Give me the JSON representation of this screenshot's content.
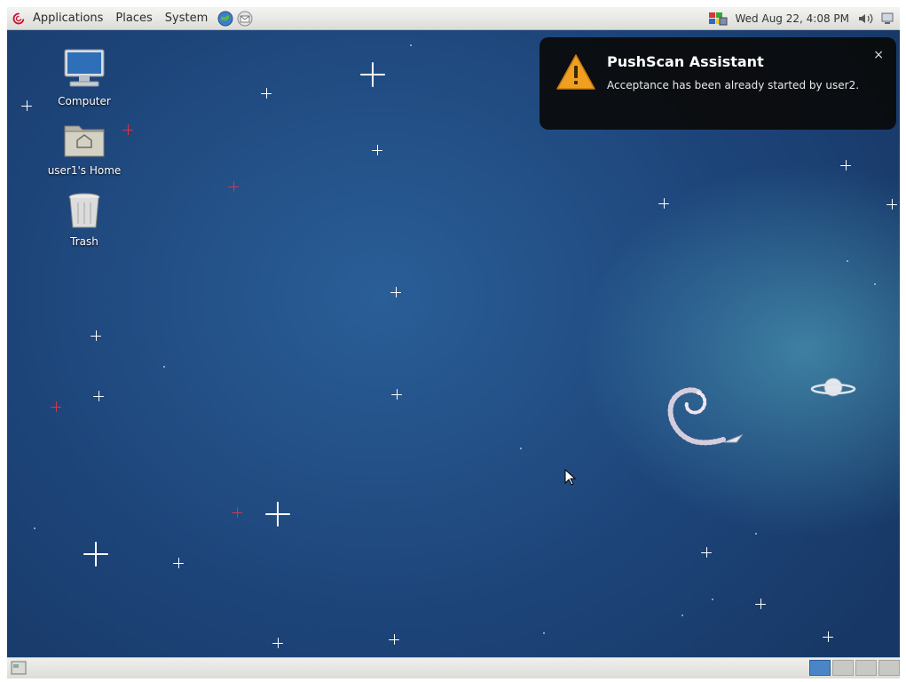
{
  "top_panel": {
    "menus": [
      "Applications",
      "Places",
      "System"
    ],
    "clock": "Wed Aug 22,  4:08 PM"
  },
  "desktop": {
    "icons": [
      {
        "label": "Computer",
        "icon": "computer-icon"
      },
      {
        "label": "user1's Home",
        "icon": "home-folder-icon"
      },
      {
        "label": "Trash",
        "icon": "trash-icon"
      }
    ]
  },
  "notification": {
    "title": "PushScan Assistant",
    "body": "Acceptance has been already started by user2.",
    "close": "×",
    "icon": "warning-icon"
  },
  "bottom_panel": {
    "workspaces": 4,
    "active_workspace": 1
  },
  "colors": {
    "desktop_bg": "#1d4479",
    "notification_bg": "#0a0a0a",
    "workspace_active": "#4a86c6",
    "warning": "#f0a020"
  }
}
